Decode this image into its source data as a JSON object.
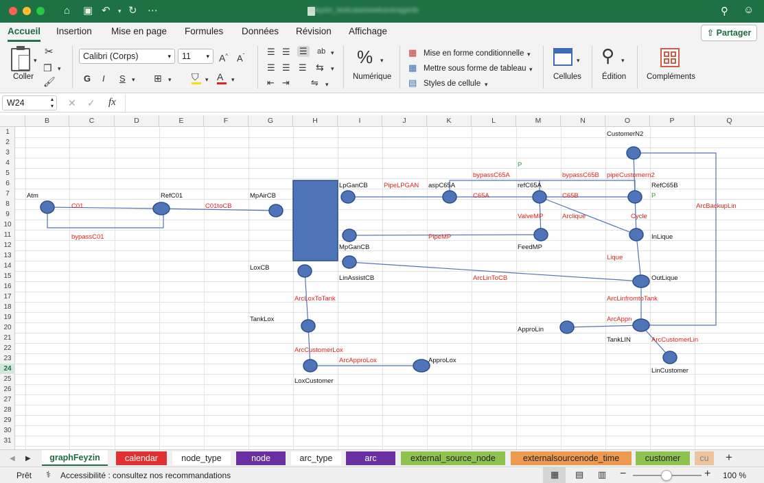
{
  "window": {
    "doc_title": "Feyzin_testcaseweekaveragenb",
    "colors": {
      "title_bar": "#1e7145"
    }
  },
  "ribbon_tabs": [
    "Accueil",
    "Insertion",
    "Mise en page",
    "Formules",
    "Données",
    "Révision",
    "Affichage"
  ],
  "share_label": "Partager",
  "ribbon": {
    "paste_label": "Coller",
    "font_name": "Calibri (Corps)",
    "font_size": "11",
    "grow_font": "A",
    "shrink_font": "A",
    "bold": "G",
    "italic": "I",
    "underline": "S",
    "number_label": "Numérique",
    "cond_format_label": "Mise en forme conditionnelle",
    "table_format_label": "Mettre sous forme de tableau",
    "cell_styles_label": "Styles de cellule",
    "cells_label": "Cellules",
    "edition_label": "Édition",
    "addins_label": "Compléments"
  },
  "formula_bar": {
    "name_box": "W24",
    "fx": "fx",
    "content": ""
  },
  "columns": [
    "B",
    "C",
    "D",
    "E",
    "F",
    "G",
    "H",
    "I",
    "J",
    "K",
    "L",
    "M",
    "N",
    "O",
    "P",
    "Q"
  ],
  "rows": [
    "1",
    "2",
    "3",
    "4",
    "5",
    "6",
    "7",
    "8",
    "9",
    "10",
    "11",
    "12",
    "13",
    "14",
    "15",
    "16",
    "17",
    "18",
    "19",
    "20",
    "21",
    "22",
    "23",
    "24",
    "25",
    "26",
    "27",
    "28",
    "29",
    "30",
    "31"
  ],
  "selected_row": "24",
  "labels": {
    "atm": "Atm",
    "refc01": "RefC01",
    "c01": "C01",
    "c01tocb": "C01toCB",
    "bypassc01": "bypassC01",
    "mpaircb": "MpAirCB",
    "lpgancb": "LpGanCB",
    "pipelpgan": "PipeLPGAN",
    "aspc65a": "aspC65A",
    "refc65a": "refC65A",
    "refc65b": "RefC65B",
    "bypassc65a": "bypassC65A",
    "bypassc65b": "bypassC65B",
    "pipecustomern2": "pipeCustomern2",
    "customern2": "CustomerN2",
    "p4": "P",
    "p8": "P",
    "c65a": "C65A",
    "c65b": "C65B",
    "arcbackuplin": "ArcBackupLin",
    "valvemp": "ValveMP",
    "arclique": "Arclique",
    "cycle": "Cycle",
    "inlique": "InLique",
    "pipemp": "PipeMP",
    "mpgancb": "MpGanCB",
    "feedmp": "FeedMP",
    "lique": "Lique",
    "loxcb": "LoxCB",
    "linassistcb": "LinAssistCB",
    "arclintocb": "ArcLinToCB",
    "outlique": "OutLique",
    "arcloxtotank": "ArcLoxToTank",
    "arclinfromtotank": "ArcLinfromtoTank",
    "tanklox": "TankLox",
    "arcapprolin": "ArcApproLin",
    "approlin": "ApproLin",
    "tanklin": "TankLIN",
    "arccustomerlin": "ArcCustomerLin",
    "arccustomerlox": "ArcCustomerLox",
    "arcapprolox": "ArcApproLox",
    "approlox": "ApproLox",
    "lincustomer": "LinCustomer",
    "loxcustomer": "LoxCustomer"
  },
  "sheet_tabs": [
    {
      "label": "graphFeyzin",
      "color": "#ffffff",
      "text": "#1e6b40",
      "active": true
    },
    {
      "label": "calendar",
      "color": "#e03030",
      "text": "#ffffff"
    },
    {
      "label": "node_type",
      "color": "#ffffff",
      "text": "#222222"
    },
    {
      "label": "node",
      "color": "#6a2fa0",
      "text": "#ffffff"
    },
    {
      "label": "arc_type",
      "color": "#ffffff",
      "text": "#222222"
    },
    {
      "label": "arc",
      "color": "#6a2fa0",
      "text": "#ffffff"
    },
    {
      "label": "external_source_node",
      "color": "#8fc24f",
      "text": "#222222"
    },
    {
      "label": "externalsourcenode_time",
      "color": "#ee9a50",
      "text": "#222222"
    },
    {
      "label": "customer",
      "color": "#8fc24f",
      "text": "#222222"
    },
    {
      "label": "cu",
      "color": "#ee9a50",
      "text": "#222222"
    }
  ],
  "status": {
    "ready": "Prêt",
    "accessibility": "Accessibilité : consultez nos recommandations",
    "zoom": "100 %"
  },
  "colors": {
    "node_fill": "#4f74b8",
    "node_stroke": "#2d4f8e",
    "edge": "#4f74b8",
    "label_red": "#e0231c",
    "label_green": "#2f9d3e"
  }
}
